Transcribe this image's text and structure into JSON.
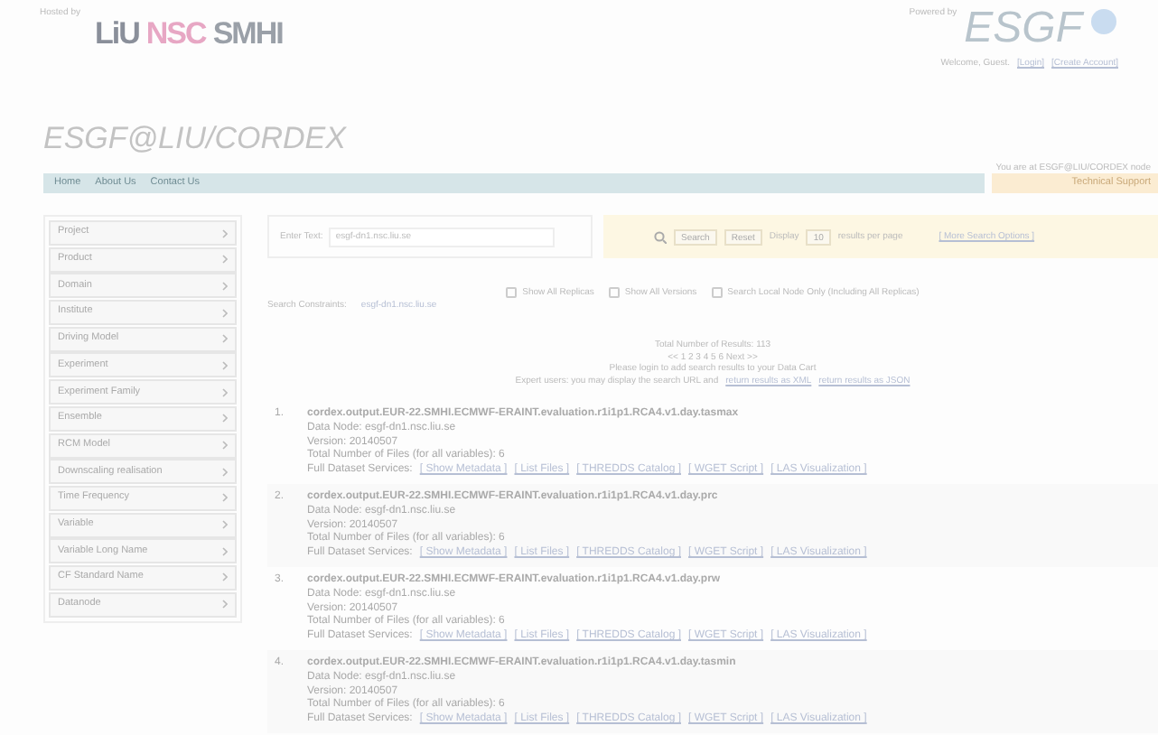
{
  "header": {
    "hosted_by": "Hosted by",
    "logos": [
      "LiU",
      "NSC",
      "SMHI"
    ],
    "powered_by": "Powered by",
    "esgf_logo": "ESGF",
    "welcome": "Welcome, Guest.",
    "account_links": [
      "[Login]",
      "[Create Account]"
    ]
  },
  "site_title": "ESGF@LIU/CORDEX",
  "nav": {
    "items": [
      "Home",
      "About Us",
      "Contact Us"
    ],
    "node_note": "You are at ESGF@LIU/CORDEX node",
    "support": "Technical Support"
  },
  "facets": [
    "Project",
    "Product",
    "Domain",
    "Institute",
    "Driving Model",
    "Experiment",
    "Experiment Family",
    "Ensemble",
    "RCM Model",
    "Downscaling realisation",
    "Time Frequency",
    "Variable",
    "Variable Long Name",
    "CF Standard Name",
    "Datanode"
  ],
  "search": {
    "label": "Enter Text:",
    "value": "esgf-dn1.nsc.liu.se",
    "buttons": [
      "Search",
      "Reset"
    ],
    "display_label": "Display",
    "display_value": "10",
    "per_page": "results per page",
    "more": "[ More Search Options ]"
  },
  "options": [
    {
      "label": "Show All Replicas",
      "checked": false
    },
    {
      "label": "Show All Versions",
      "checked": false
    },
    {
      "label": "Search Local Node Only (Including All Replicas)",
      "checked": false
    }
  ],
  "constraints": {
    "label": "Search Constraints:",
    "items": [
      "esgf-dn1.nsc.liu.se"
    ]
  },
  "summary": {
    "total": "Total Number of Results: 113",
    "pager": "<< 1 2 3 4 5 6 Next >>",
    "login_note": "Please login to add search results to your Data Cart",
    "expert": "Expert users: you may display the search URL and",
    "links": [
      "return results as XML",
      "return results as JSON"
    ]
  },
  "results": [
    {
      "number": "1.",
      "title": "cordex.output.EUR-22.SMHI.ECMWF-ERAINT.evaluation.r1i1p1.RCA4.v1.day.tasmax",
      "data_node": "Data Node: esgf-dn1.nsc.liu.se",
      "version": "Version: 20140507",
      "files": "Total Number of Files (for all variables): 6",
      "services_label": "Full Dataset Services:",
      "services": [
        "[ Show Metadata ]",
        "[ List Files ]",
        "[ THREDDS Catalog ]",
        "[ WGET Script ]",
        "[ LAS Visualization ]"
      ]
    },
    {
      "number": "2.",
      "title": "cordex.output.EUR-22.SMHI.ECMWF-ERAINT.evaluation.r1i1p1.RCA4.v1.day.prc",
      "data_node": "Data Node: esgf-dn1.nsc.liu.se",
      "version": "Version: 20140507",
      "files": "Total Number of Files (for all variables): 6",
      "services_label": "Full Dataset Services:",
      "services": [
        "[ Show Metadata ]",
        "[ List Files ]",
        "[ THREDDS Catalog ]",
        "[ WGET Script ]",
        "[ LAS Visualization ]"
      ]
    },
    {
      "number": "3.",
      "title": "cordex.output.EUR-22.SMHI.ECMWF-ERAINT.evaluation.r1i1p1.RCA4.v1.day.prw",
      "data_node": "Data Node: esgf-dn1.nsc.liu.se",
      "version": "Version: 20140507",
      "files": "Total Number of Files (for all variables): 6",
      "services_label": "Full Dataset Services:",
      "services": [
        "[ Show Metadata ]",
        "[ List Files ]",
        "[ THREDDS Catalog ]",
        "[ WGET Script ]",
        "[ LAS Visualization ]"
      ]
    },
    {
      "number": "4.",
      "title": "cordex.output.EUR-22.SMHI.ECMWF-ERAINT.evaluation.r1i1p1.RCA4.v1.day.tasmin",
      "data_node": "Data Node: esgf-dn1.nsc.liu.se",
      "version": "Version: 20140507",
      "files": "Total Number of Files (for all variables): 6",
      "services_label": "Full Dataset Services:",
      "services": [
        "[ Show Metadata ]",
        "[ List Files ]",
        "[ THREDDS Catalog ]",
        "[ WGET Script ]",
        "[ LAS Visualization ]"
      ]
    }
  ]
}
